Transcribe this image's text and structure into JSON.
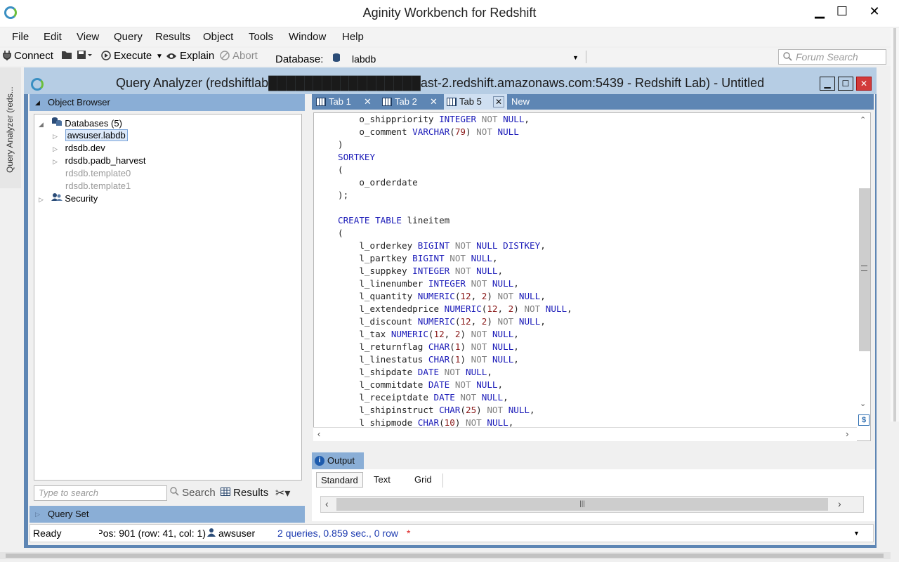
{
  "app": {
    "title": "Aginity Workbench for Redshift",
    "window_controls": {
      "minimize": "▁",
      "maximize": "☐",
      "close": "✕"
    }
  },
  "menubar": [
    "File",
    "Edit",
    "View",
    "Query",
    "Results",
    "Object",
    "Tools",
    "Window",
    "Help"
  ],
  "toolbar": {
    "connect": "Connect",
    "execute": "Execute",
    "explain": "Explain",
    "abort": "Abort",
    "database_label": "Database:",
    "database_value": "labdb",
    "forum_search_placeholder": "Forum Search"
  },
  "side_tab": {
    "label": "Query Analyzer (reds..."
  },
  "query_analyzer": {
    "title": "Query Analyzer (redshiftlab█████████████████ast-2.redshift.amazonaws.com:5439 - Redshift Lab) - Untitled",
    "object_browser_label": "Object Browser",
    "tree": {
      "databases": "Databases (5)",
      "items": [
        "awsuser.labdb",
        "rdsdb.dev",
        "rdsdb.padb_harvest",
        "rdsdb.template0",
        "rdsdb.template1"
      ],
      "security": "Security"
    },
    "search_placeholder": "Type to search",
    "search_button": "Search",
    "results_button": "Results",
    "query_set_label": "Query Set"
  },
  "tabs": [
    {
      "label": "Tab 1",
      "active": false
    },
    {
      "label": "Tab 2",
      "active": false
    },
    {
      "label": "Tab 5",
      "active": true
    },
    {
      "label": "New",
      "active": false
    }
  ],
  "editor": {
    "lines": [
      "    o_shippriority INTEGER NOT NULL,",
      "    o_comment VARCHAR(79) NOT NULL",
      ")",
      "SORTKEY",
      "(",
      "    o_orderdate",
      ");",
      "",
      "CREATE TABLE lineitem",
      "(",
      "    l_orderkey BIGINT NOT NULL DISTKEY,",
      "    l_partkey BIGINT NOT NULL,",
      "    l_suppkey INTEGER NOT NULL,",
      "    l_linenumber INTEGER NOT NULL,",
      "    l_quantity NUMERIC(12, 2) NOT NULL,",
      "    l_extendedprice NUMERIC(12, 2) NOT NULL,",
      "    l_discount NUMERIC(12, 2) NOT NULL,",
      "    l_tax NUMERIC(12, 2) NOT NULL,",
      "    l_returnflag CHAR(1) NOT NULL,",
      "    l_linestatus CHAR(1) NOT NULL,",
      "    l_shipdate DATE NOT NULL,",
      "    l_commitdate DATE NOT NULL,",
      "    l_receiptdate DATE NOT NULL,",
      "    l_shipinstruct CHAR(25) NOT NULL,",
      "    l_shipmode CHAR(10) NOT NULL,"
    ]
  },
  "output": {
    "label": "Output",
    "tabs": [
      "Standard",
      "Text",
      "Grid"
    ]
  },
  "statusbar": {
    "state": "Ready",
    "position": "Pos: 901 (row: 41, col: 1)",
    "user": "awsuser",
    "summary": "2 queries, 0.859 sec., 0 row",
    "modified": "*"
  },
  "colors": {
    "keyword": "#1a1ab8",
    "not_null": "#808080",
    "number": "#8a1a1a",
    "panel_header": "#8aaed6",
    "window_frame": "#5e86b4"
  }
}
